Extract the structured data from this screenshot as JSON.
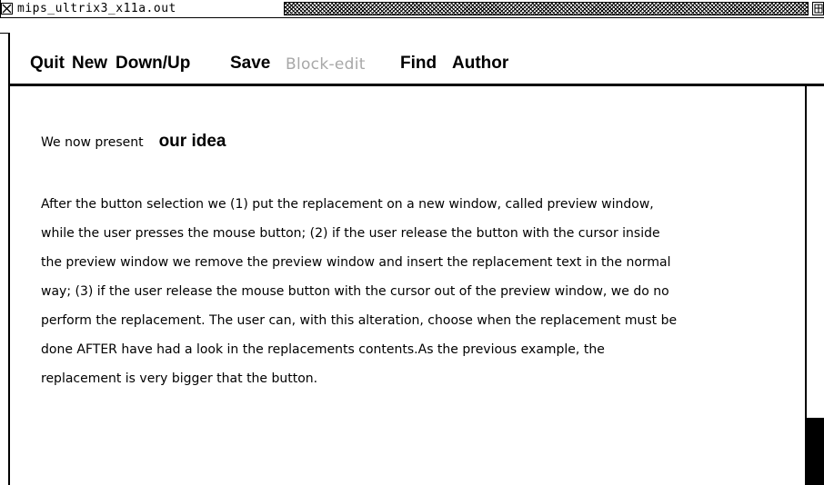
{
  "window": {
    "title": "mips_ultrix3_x11a.out",
    "close_icon": "x-box-icon",
    "maximize_icon": "window-maximize-icon"
  },
  "menu": {
    "items": [
      {
        "label": "Quit",
        "enabled": true
      },
      {
        "label": "New",
        "enabled": true
      },
      {
        "label": "Down/Up",
        "enabled": true
      },
      {
        "label": "Save",
        "enabled": true
      },
      {
        "label": "Block-edit",
        "enabled": false
      },
      {
        "label": "Find",
        "enabled": true
      },
      {
        "label": "Author",
        "enabled": true
      }
    ]
  },
  "document": {
    "intro_text": "We now present",
    "intro_emphasis": "our idea",
    "paragraph_lines": [
      "After the button selection we  (1)  put the replacement on a new window, called preview window,",
      "while the user presses the mouse button; (2) if the user release the button with the cursor inside",
      "the preview window we remove the preview window and insert the replacement text in the normal",
      "way; (3) if the user release the mouse button with the cursor out of the preview window, we do no",
      "perform the replacement. The user can, with this alteration, choose when the replacement must be",
      "done AFTER have had a look in the replacements contents.As the previous example, the",
      "replacement is very bigger that the button."
    ]
  },
  "scrollbar": {
    "thumb_color": "#000000"
  }
}
